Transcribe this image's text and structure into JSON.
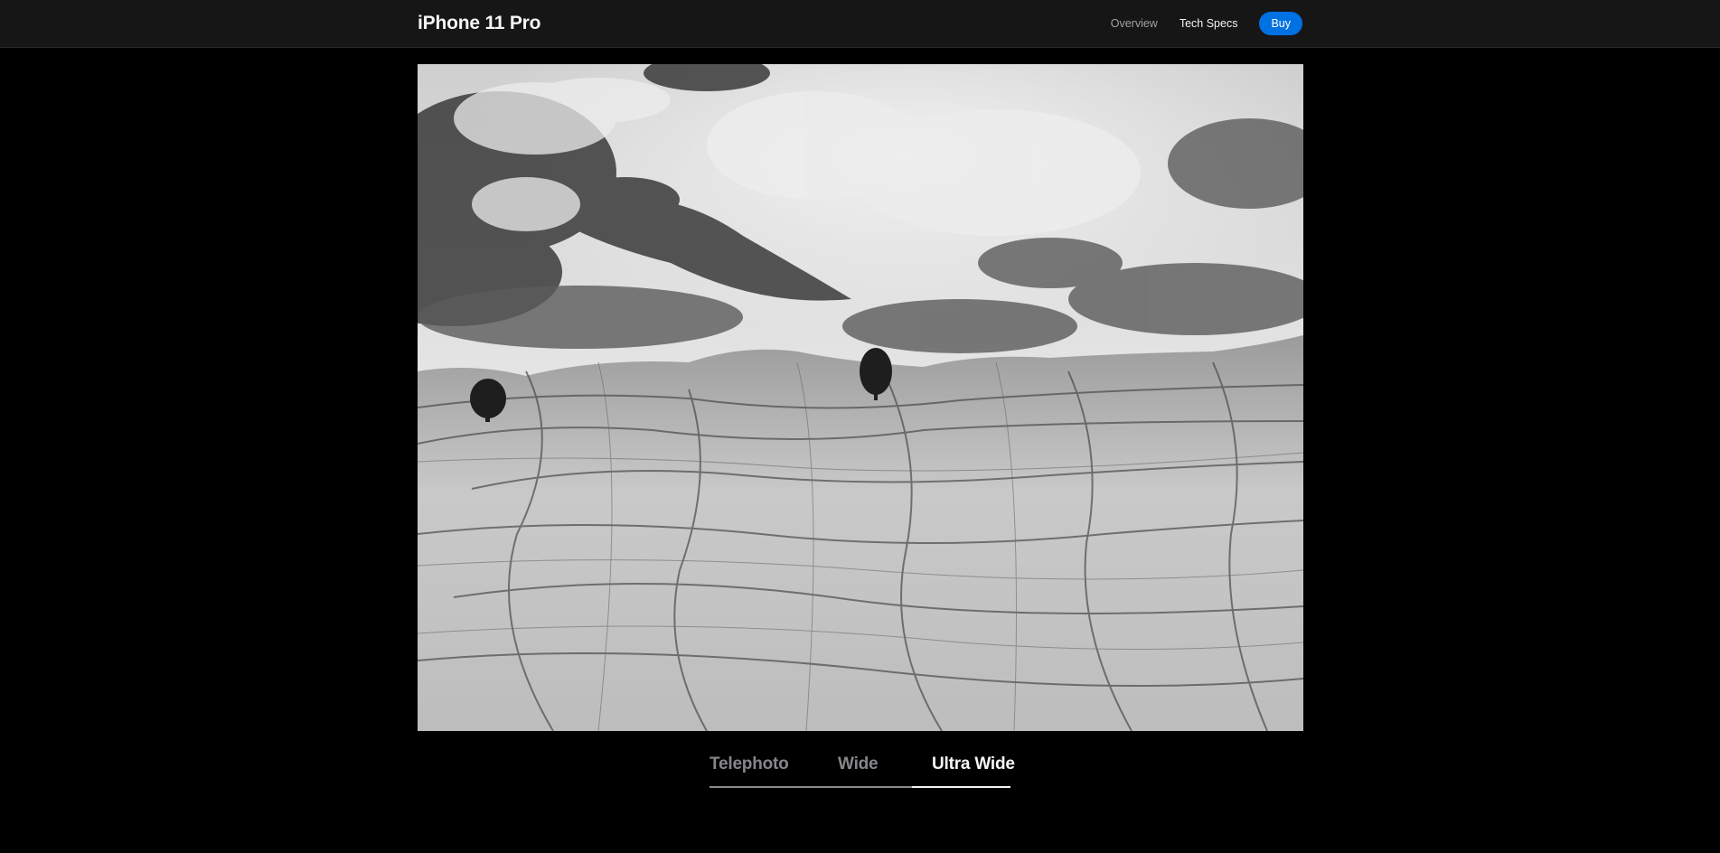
{
  "nav": {
    "title": "iPhone 11 Pro",
    "links": [
      {
        "label": "Overview"
      },
      {
        "label": "Tech Specs"
      }
    ],
    "buy_label": "Buy"
  },
  "gallery": {
    "tabs": [
      {
        "label": "Telephoto",
        "active": false
      },
      {
        "label": "Wide",
        "active": false
      },
      {
        "label": "Ultra Wide",
        "active": true
      }
    ]
  },
  "colors": {
    "accent": "#0071e3",
    "background": "#000000",
    "nav_background": "#161617"
  }
}
